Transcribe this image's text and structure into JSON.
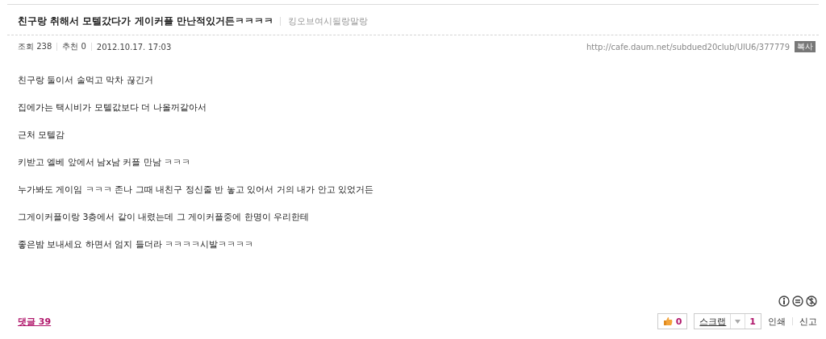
{
  "post": {
    "title": "친구랑 취해서 모텔갔다가 게이커플 만난적있거든ㅋㅋㅋㅋ",
    "author": "킹오브여시될랑말랑"
  },
  "meta": {
    "views_label": "조회",
    "views": "238",
    "recommend_label": "추천",
    "recommend": "0",
    "date": "2012.10.17. 17:03",
    "url": "http://cafe.daum.net/subdued20club/UlU6/377779",
    "copy_label": "복사"
  },
  "body": [
    "친구랑 둘이서 술먹고 막차 끊긴거",
    "집에가는 택시비가 모텔값보다 더 나올꺼같아서",
    "근처 모텔감",
    "키받고 엘베 앞에서 남x남 커플 만남 ㅋㅋㅋ",
    "누가봐도 게이임 ㅋㅋㅋ 존나 그때 내친구  정신줄 반 놓고 있어서 거의 내가 안고 있었거든",
    "그게이커플이랑 3층에서 같이 내렸는데 그 게이커플중에 한명이 우리한테",
    "좋은밤 보내세요 하면서 엄지 들더라 ㅋㅋㅋㅋ시발ㅋㅋㅋㅋ"
  ],
  "footer": {
    "comments": "댓글 39",
    "likes": "0",
    "scrap_label": "스크랩",
    "scrap_count": "1",
    "print": "인쇄",
    "report": "신고"
  }
}
